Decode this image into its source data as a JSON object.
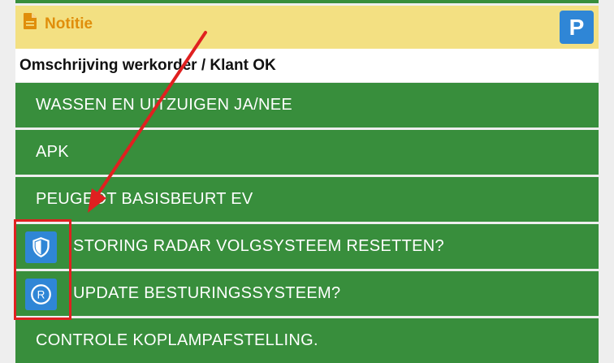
{
  "notitie": {
    "label": "Notitie",
    "icon": "note-icon"
  },
  "parking_button": {
    "label": "P"
  },
  "section": {
    "heading": "Omschrijving werkorder / Klant OK"
  },
  "tasks": [
    {
      "label": "WASSEN EN UITZUIGEN JA/NEE"
    },
    {
      "label": "APK"
    },
    {
      "label": "PEUGEOT BASISBEURT EV"
    },
    {
      "label": "STORING RADAR VOLGSYSTEEM RESETTEN?",
      "icon": "shield-icon"
    },
    {
      "label": "UPDATE BESTURINGSSYSTEEM?",
      "icon": "registered-icon"
    },
    {
      "label": "CONTROLE KOPLAMPAFSTELLING."
    }
  ],
  "colors": {
    "row_green": "#388e3c",
    "note_yellow": "#f3e082",
    "note_text": "#e08e0b",
    "icon_blue": "#2f86d6",
    "annotation_red": "#e02020"
  }
}
